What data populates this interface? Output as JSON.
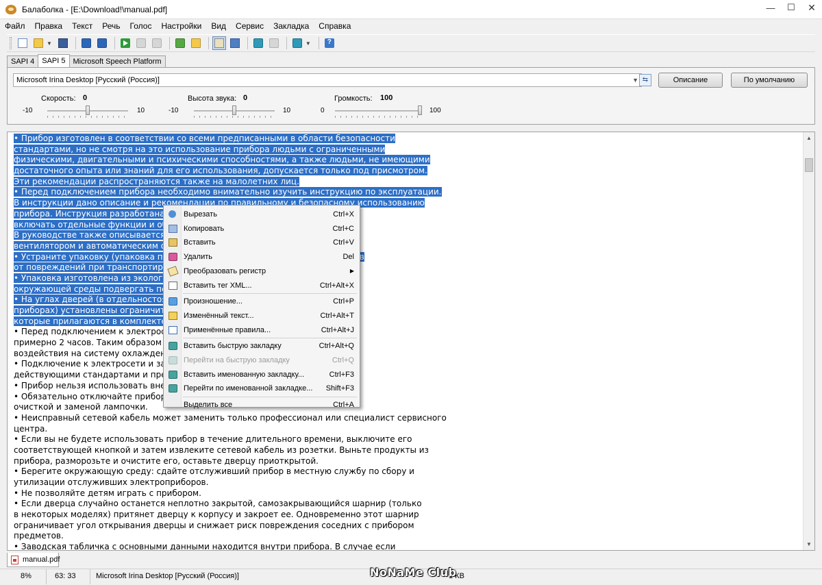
{
  "window": {
    "title": "Балаболка - [E:\\Download!\\manual.pdf]",
    "min_glyph": "—",
    "max_glyph": "☐",
    "close_glyph": "✕"
  },
  "menu": [
    "Файл",
    "Правка",
    "Текст",
    "Речь",
    "Голос",
    "Настройки",
    "Вид",
    "Сервис",
    "Закладка",
    "Справка"
  ],
  "toolbar": {
    "icons": [
      "new-doc-icon",
      "open-folder-icon",
      "save-icon",
      "save-as-audio-icon",
      "split-audio-icon",
      "play-icon",
      "pause-icon",
      "stop-icon",
      "spell-check-icon",
      "clipboard-read-icon",
      "clipboard-watch-icon",
      "dictionary-icon",
      "translate-icon",
      "bookmark-disabled-icon",
      "bookmark-icon",
      "help-icon"
    ],
    "help_glyph": "?",
    "dropdown_glyph": "▼"
  },
  "engine_tabs": [
    "SAPI 4",
    "SAPI 5",
    "Microsoft Speech Platform"
  ],
  "voice": {
    "selected": "Microsoft Irina Desktop [Русский (Россия)]",
    "dropdown_glyph": "▼",
    "swap_glyph": "⇆",
    "description_button": "Описание",
    "default_button": "По умолчанию",
    "rate": {
      "label": "Скорость:",
      "value": "0",
      "min": "-10",
      "max": "10",
      "position": 0.5
    },
    "pitch": {
      "label": "Высота звука:",
      "value": "0",
      "min": "-10",
      "max": "10",
      "position": 0.5
    },
    "volume": {
      "label": "Громкость:",
      "value": "100",
      "min": "0",
      "max": "100",
      "position": 1.0
    }
  },
  "editor": {
    "lines": [
      "• Прибор изготовлен в соответствии со всеми предписанными в области безопасности",
      "стандартами, но не смотря на это использование прибора людьми с ограниченными",
      "физическими, двигательными и психическими способностями, а также людьми, не имеющими",
      "достаточного опыта или знаний для его использования, допускается только под присмотром.",
      "Эти рекомендации распространяются также на малолетних лиц.",
      "• Перед подключением прибора необходимо внимательно изучить инструкцию по эксплуатации.",
      "В инструкции дано описание и рекомендации по правильному и безопасному использованию",
      "прибора. Инструкция разработана для                                             ому может",
      "включать отдельные функции и обо",
      "В руководстве также описывается в                                              оборудуется",
      "вентилятором и автоматическим от",
      "• Устраните упаковку (упаковка пре                                              ых компонентов",
      "от повреждений при транспортиров",
      "• Упаковка изготовлена из экологи                                              без ущерба для",
      "окружающей среды подвергать пере",
      "• На углах дверей (в отдельностоящ                                             аемых",
      "приборах) установлены ограничите                                              те заглушки,",
      "которые прилагаются в комплекте.",
      "• Перед подключением к электросет                                              в течение",
      "примерно 2 часов. Таким образом м                                              вследствие",
      "воздействия на систему охлаждени",
      "• Подключение к электросети и заз                                              ответствии с",
      "действующими стандартами и предп",
      "• Прибор нельзя использовать вне п                                             ождя.",
      "• Обязательно отключайте прибор с                                              озетки) перед",
      "очисткой и заменой лампочки.",
      "• Неисправный сетевой кабель может заменить только профессионал или специалист сервисного",
      "центра.",
      "• Если вы не будете использовать прибор в течение длительного времени, выключите его",
      "соответствующей кнопкой и затем извлеките сетевой кабель из розетки. Выньте продукты из",
      "прибора, разморозьте и очистите его, оставьте дверцу приоткрытой.",
      "• Берегите окружающую среду: сдайте отслуживший прибор в местную службу по сбору и",
      "утилизации отслуживших электроприборов.",
      "• Не позволяйте детям играть с прибором.",
      "• Если дверца случайно останется неплотно закрытой, самозакрывающийся шарнир (только",
      "в некоторых моделях) притянет дверцу к корпусу и закроет ее. Одновременно этот шарнир",
      "ограничивает угол открывания дверцы и снижает риск повреждения соседних с прибором",
      "предметов.",
      "• Заводская табличка с основными данными находится внутри прибора. В случае если"
    ],
    "selected_line_count": 18,
    "scroll_up_glyph": "▲",
    "scroll_down_glyph": "▼"
  },
  "context_menu": [
    {
      "label": "Вырезать",
      "shortcut": "Ctrl+X",
      "icon": "cut-icon",
      "enabled": true
    },
    {
      "label": "Копировать",
      "shortcut": "Ctrl+C",
      "icon": "copy-icon",
      "enabled": true
    },
    {
      "label": "Вставить",
      "shortcut": "Ctrl+V",
      "icon": "paste-icon",
      "enabled": true
    },
    {
      "label": "Удалить",
      "shortcut": "Del",
      "icon": "delete-icon",
      "enabled": true
    },
    {
      "label": "Преобразовать регистр",
      "shortcut": "",
      "icon": "change-case-icon",
      "enabled": true,
      "submenu": true
    },
    {
      "label": "Вставить тег XML...",
      "shortcut": "Ctrl+Alt+X",
      "icon": "xml-tag-icon",
      "enabled": true
    },
    {
      "separator": true
    },
    {
      "label": "Произношение...",
      "shortcut": "Ctrl+P",
      "icon": "pronunciation-icon",
      "enabled": true
    },
    {
      "label": "Изменённый текст...",
      "shortcut": "Ctrl+Alt+T",
      "icon": "edited-text-icon",
      "enabled": true
    },
    {
      "label": "Применённые правила...",
      "shortcut": "Ctrl+Alt+J",
      "icon": "applied-rules-icon",
      "enabled": true
    },
    {
      "separator": true
    },
    {
      "label": "Вставить быструю закладку",
      "shortcut": "Ctrl+Alt+Q",
      "icon": "quick-bookmark-icon",
      "enabled": true
    },
    {
      "label": "Перейти на быструю закладку",
      "shortcut": "Ctrl+Q",
      "icon": "goto-quick-bookmark-icon",
      "enabled": false
    },
    {
      "label": "Вставить именованную закладку...",
      "shortcut": "Ctrl+F3",
      "icon": "named-bookmark-icon",
      "enabled": true
    },
    {
      "label": "Перейти по именованной закладке...",
      "shortcut": "Shift+F3",
      "icon": "goto-named-bookmark-icon",
      "enabled": true
    },
    {
      "separator": true
    },
    {
      "label": "Выделить все",
      "shortcut": "Ctrl+A",
      "icon": "",
      "enabled": true
    }
  ],
  "submenu_glyph": "▶",
  "document_tab": "manual.pdf",
  "status": {
    "zoom": "8%",
    "position": "63:  33",
    "voice": "Microsoft Irina Desktop [Русский (Россия)]",
    "size": "1 КВ",
    "watermark": "NoNaMe Club"
  }
}
